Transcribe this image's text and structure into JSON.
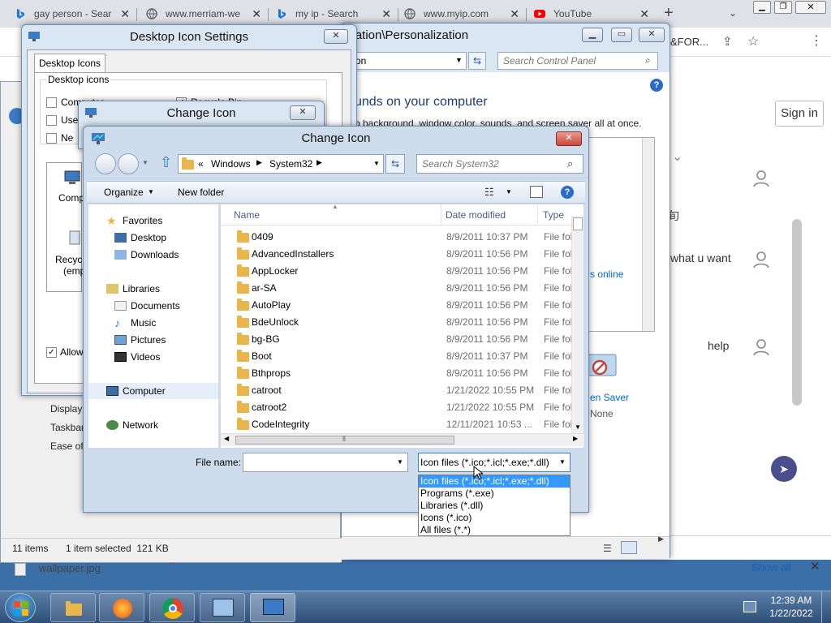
{
  "browser": {
    "tabs": [
      {
        "title": "gay person - Sear",
        "icon": "bing-icon",
        "color": "#1a73e8"
      },
      {
        "title": "www.merriam-we",
        "icon": "globe-icon",
        "color": "#5f6368"
      },
      {
        "title": "my ip - Search",
        "icon": "bing-icon",
        "color": "#1a73e8"
      },
      {
        "title": "www.myip.com",
        "icon": "globe-icon",
        "color": "#5f6368"
      },
      {
        "title": "YouTube",
        "icon": "youtube-icon",
        "color": "#ff0000"
      }
    ],
    "new_tab": "+",
    "address_fragment": "&FOR...",
    "page_texts": {
      "sign_in": "Sign in",
      "lang_char": "旬",
      "what_u_want": "what u want",
      "help": "help",
      "show_all": "Show all",
      "download_item": "wallpaper.jpg"
    }
  },
  "personalization_window": {
    "title": "ization\\Personalization",
    "address_text": "on",
    "search_placeholder": "Search Control Panel",
    "heading": "unds on your computer",
    "subtext": "p background, window color, sounds, and screen saver all at once.",
    "link_online": "s online",
    "screen_saver_label": "en Saver",
    "screen_saver_value": "None",
    "see_also": [
      "Display",
      "Taskbar",
      "Ease of"
    ],
    "status_items": "11 items",
    "status_selected": "1 item selected  121 KB"
  },
  "desktop_icon_settings": {
    "title": "Desktop Icon Settings",
    "tab": "Desktop Icons",
    "group_label": "Desktop icons",
    "checkboxes": [
      {
        "label": "Computer",
        "checked": false
      },
      {
        "label": "Recycle Bin",
        "checked": true
      },
      {
        "label": "Use",
        "checked": false
      },
      {
        "label": "Ne",
        "checked": false
      }
    ],
    "icon_labels": [
      "Comp",
      "Recyc",
      "(emp"
    ],
    "allow_label": "Allow"
  },
  "change_icon_back": {
    "title": "Change Icon"
  },
  "change_icon_dialog": {
    "title": "Change Icon",
    "breadcrumb": [
      "«",
      "Windows",
      "System32"
    ],
    "search_placeholder": "Search System32",
    "organize": "Organize",
    "new_folder": "New folder",
    "nav": {
      "favorites_header": "Favorites",
      "favorites": [
        "Desktop",
        "Downloads"
      ],
      "libraries_header": "Libraries",
      "libraries": [
        "Documents",
        "Music",
        "Pictures",
        "Videos"
      ],
      "computer": "Computer",
      "network": "Network"
    },
    "columns": [
      "Name",
      "Date modified",
      "Type"
    ],
    "files": [
      {
        "name": "0409",
        "date": "8/9/2011 10:37 PM",
        "type": "File fol"
      },
      {
        "name": "AdvancedInstallers",
        "date": "8/9/2011 10:56 PM",
        "type": "File fol"
      },
      {
        "name": "AppLocker",
        "date": "8/9/2011 10:56 PM",
        "type": "File fol"
      },
      {
        "name": "ar-SA",
        "date": "8/9/2011 10:56 PM",
        "type": "File fol"
      },
      {
        "name": "AutoPlay",
        "date": "8/9/2011 10:56 PM",
        "type": "File fol"
      },
      {
        "name": "BdeUnlock",
        "date": "8/9/2011 10:56 PM",
        "type": "File fol"
      },
      {
        "name": "bg-BG",
        "date": "8/9/2011 10:56 PM",
        "type": "File fol"
      },
      {
        "name": "Boot",
        "date": "8/9/2011 10:37 PM",
        "type": "File fol"
      },
      {
        "name": "Bthprops",
        "date": "8/9/2011 10:56 PM",
        "type": "File fol"
      },
      {
        "name": "catroot",
        "date": "1/21/2022 10:55 PM",
        "type": "File fol"
      },
      {
        "name": "catroot2",
        "date": "1/21/2022 10:55 PM",
        "type": "File fol"
      },
      {
        "name": "CodeIntegrity",
        "date": "12/11/2021 10:53 ...",
        "type": "File fol"
      }
    ],
    "file_name_label": "File name:",
    "file_name_value": "",
    "filter_selected": "Icon files (*.ico;*.icl;*.exe;*.dll)",
    "filter_options": [
      "Icon files (*.ico;*.icl;*.exe;*.dll)",
      "Programs (*.exe)",
      "Libraries (*.dll)",
      "Icons (*.ico)",
      "All files (*.*)"
    ]
  },
  "taskbar": {
    "time": "12:39 AM",
    "date": "1/22/2022"
  },
  "colors": {
    "selection_blue": "#3399ff",
    "close_red": "#c9463d",
    "link_blue": "#0066cc"
  }
}
